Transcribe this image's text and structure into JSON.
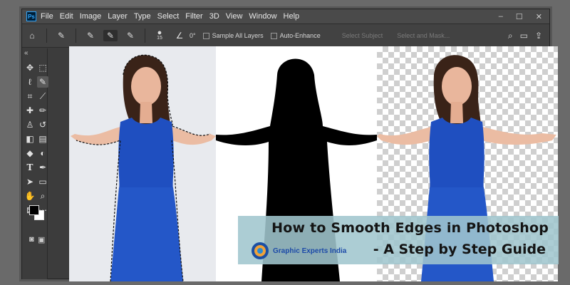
{
  "app": {
    "logo_text": "Ps",
    "menu": [
      "File",
      "Edit",
      "Image",
      "Layer",
      "Type",
      "Select",
      "Filter",
      "3D",
      "View",
      "Window",
      "Help"
    ],
    "window_controls": [
      "–",
      "☐",
      "✕"
    ]
  },
  "options_bar": {
    "brush_size": "15",
    "angle": "0°",
    "sample_all_layers": "Sample All Layers",
    "auto_enhance": "Auto-Enhance",
    "select_subject": "Select Subject",
    "select_and_mask": "Select and Mask..."
  },
  "toolbox": {
    "collapse": "«",
    "tools": [
      "move-icon",
      "marquee-icon",
      "lasso-icon",
      "quick-selection-icon",
      "crop-icon",
      "eyedropper-icon",
      "healing-icon",
      "brush-icon",
      "stamp-icon",
      "history-brush-icon",
      "eraser-icon",
      "gradient-icon",
      "blur-icon",
      "dodge-icon",
      "type-icon",
      "pen-icon",
      "path-selection-icon",
      "shape-icon",
      "hand-icon",
      "zoom-icon",
      "frame-icon",
      "more-icon"
    ]
  },
  "colors": {
    "foreground": "#000000",
    "background": "#ffffff",
    "dress": "#1f4fc0",
    "banner": "#a0c6ce"
  },
  "banner": {
    "title_line1": "How to Smooth Edges in Photoshop",
    "title_line2": "- A Step by Step Guide",
    "brand": "Graphic Experts India"
  }
}
